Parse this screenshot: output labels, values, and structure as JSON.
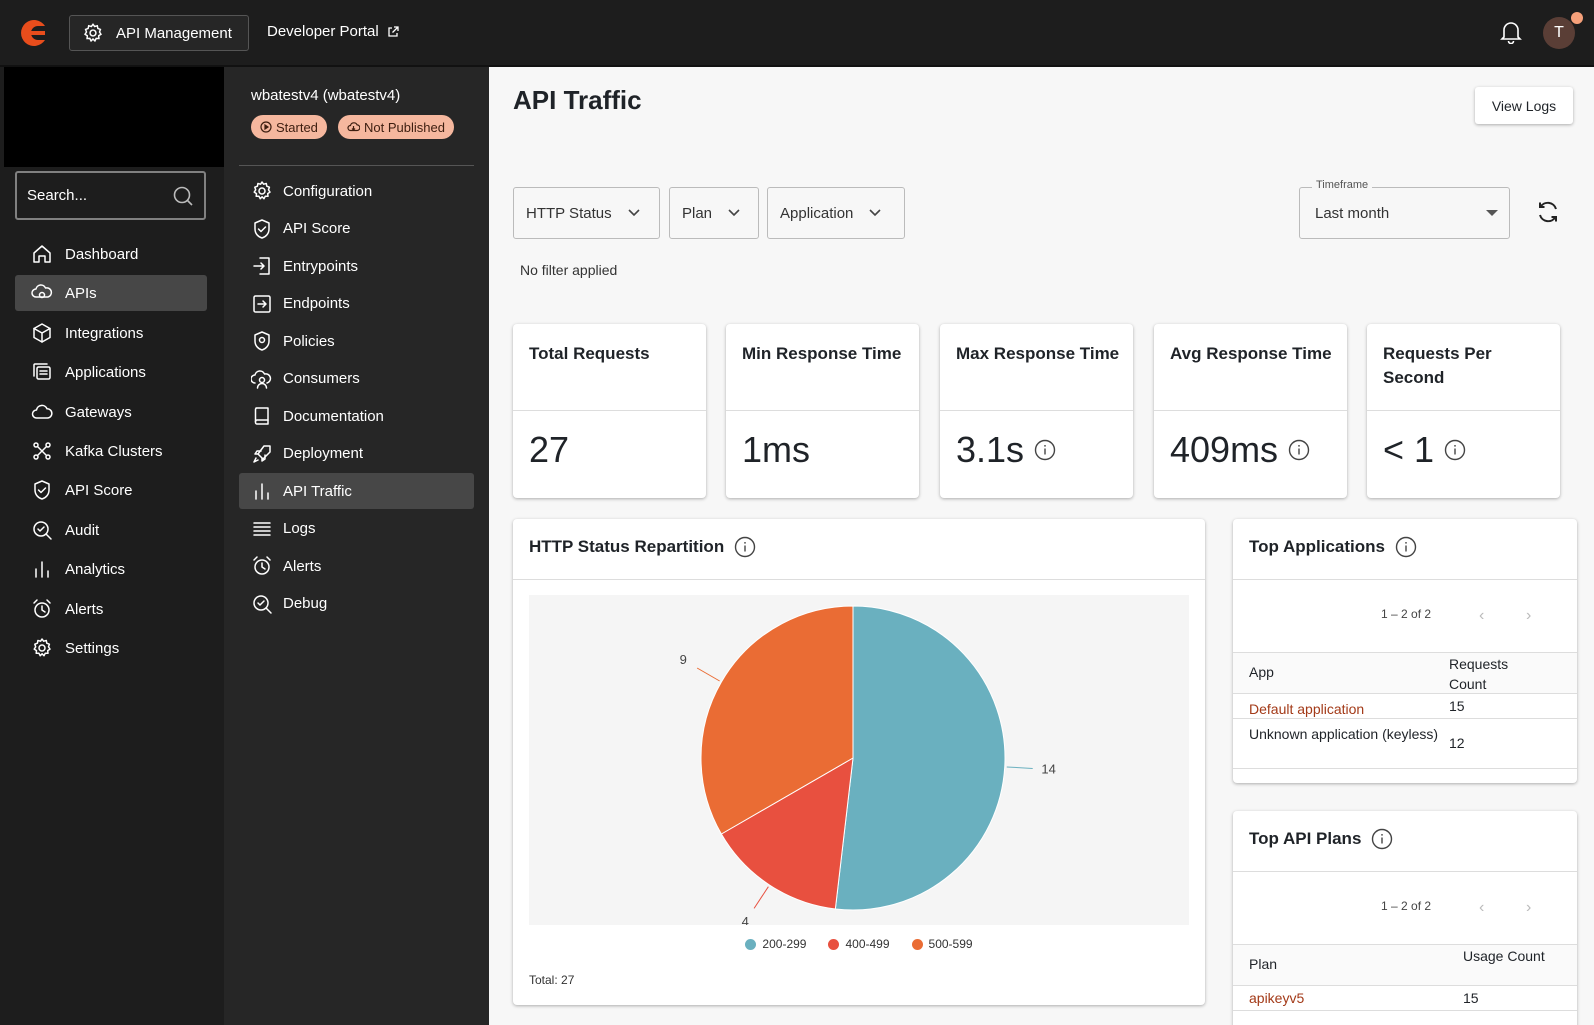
{
  "topbar": {
    "app_button": "API Management",
    "dev_portal": "Developer Portal",
    "avatar_initial": "T"
  },
  "leftnav": {
    "search_placeholder": "Search...",
    "items": [
      {
        "label": "Dashboard",
        "icon": "home-icon"
      },
      {
        "label": "APIs",
        "icon": "apis-icon",
        "active": true
      },
      {
        "label": "Integrations",
        "icon": "cube-icon"
      },
      {
        "label": "Applications",
        "icon": "applications-icon"
      },
      {
        "label": "Gateways",
        "icon": "cloud-icon"
      },
      {
        "label": "Kafka Clusters",
        "icon": "kafka-icon"
      },
      {
        "label": "API Score",
        "icon": "shield-check-icon"
      },
      {
        "label": "Audit",
        "icon": "audit-search-icon"
      },
      {
        "label": "Analytics",
        "icon": "bar-chart-icon"
      },
      {
        "label": "Alerts",
        "icon": "alarm-icon"
      },
      {
        "label": "Settings",
        "icon": "gear-icon"
      }
    ]
  },
  "api": {
    "name": "wbatestv4 (wbatestv4)",
    "status_started": "Started",
    "status_published": "Not Published"
  },
  "subnav": {
    "items": [
      {
        "label": "Configuration",
        "icon": "gear-icon"
      },
      {
        "label": "API Score",
        "icon": "shield-check-icon"
      },
      {
        "label": "Entrypoints",
        "icon": "entrypoint-icon"
      },
      {
        "label": "Endpoints",
        "icon": "endpoint-icon"
      },
      {
        "label": "Policies",
        "icon": "policy-shield-icon"
      },
      {
        "label": "Consumers",
        "icon": "consumers-icon"
      },
      {
        "label": "Documentation",
        "icon": "book-icon"
      },
      {
        "label": "Deployment",
        "icon": "rocket-icon"
      },
      {
        "label": "API Traffic",
        "icon": "bar-chart-icon",
        "active": true
      },
      {
        "label": "Logs",
        "icon": "list-icon"
      },
      {
        "label": "Alerts",
        "icon": "alarm-icon"
      },
      {
        "label": "Debug",
        "icon": "debug-icon"
      }
    ]
  },
  "main": {
    "title": "API Traffic",
    "view_logs": "View Logs",
    "filters": {
      "http_status": "HTTP Status",
      "plan": "Plan",
      "application": "Application"
    },
    "timeframe_label": "Timeframe",
    "timeframe_value": "Last month",
    "no_filter": "No filter applied"
  },
  "stats": [
    {
      "title": "Total Requests",
      "value": "27",
      "info": false
    },
    {
      "title": "Min Response Time",
      "value": "1ms",
      "info": false
    },
    {
      "title": "Max Response Time",
      "value": "3.1s",
      "info": true
    },
    {
      "title": "Avg Response Time",
      "value": "409ms",
      "info": true
    },
    {
      "title": "Requests Per Second",
      "value": "< 1",
      "info": true
    }
  ],
  "http_panel": {
    "title": "HTTP Status Repartition",
    "total": "Total: 27"
  },
  "chart_data": {
    "type": "pie",
    "title": "HTTP Status Repartition",
    "series": [
      {
        "name": "200-299",
        "value": 14,
        "color": "#6ab0bf"
      },
      {
        "name": "400-499",
        "value": 4,
        "color": "#e8503f"
      },
      {
        "name": "500-599",
        "value": 9,
        "color": "#ea6c34"
      }
    ]
  },
  "top_apps": {
    "title": "Top Applications",
    "pager": "1 – 2 of 2",
    "col1": "App",
    "col2": "Requests Count",
    "rows": [
      {
        "name": "Default application",
        "count": "15",
        "link": true
      },
      {
        "name": "Unknown application (keyless)",
        "count": "12",
        "link": false
      }
    ]
  },
  "top_plans": {
    "title": "Top API Plans",
    "pager": "1 – 2 of 2",
    "col1": "Plan",
    "col2": "Usage Count",
    "rows": [
      {
        "name": "apikeyv5",
        "count": "15",
        "link": true
      }
    ]
  }
}
